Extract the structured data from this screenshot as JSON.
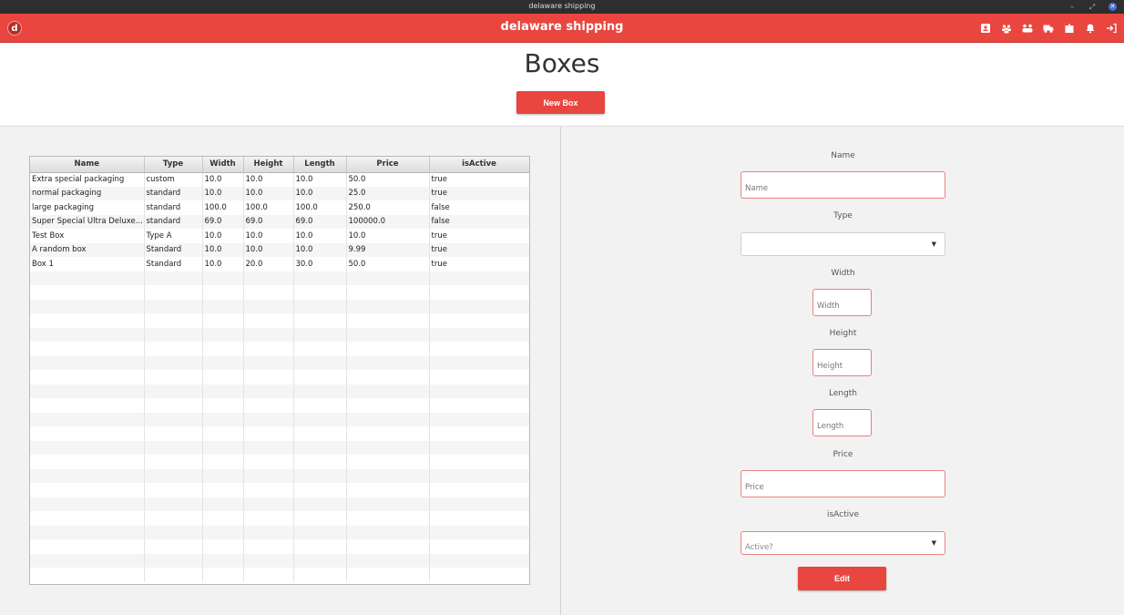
{
  "window": {
    "title": "delaware shipping"
  },
  "header": {
    "logo_letter": "d",
    "app_title": "delaware shipping"
  },
  "page": {
    "title": "Boxes",
    "new_box_label": "New Box"
  },
  "table": {
    "columns": [
      "Name",
      "Type",
      "Width",
      "Height",
      "Length",
      "Price",
      "isActive"
    ],
    "rows": [
      [
        "Extra special packaging",
        "custom",
        "10.0",
        "10.0",
        "10.0",
        "50.0",
        "true"
      ],
      [
        "normal packaging",
        "standard",
        "10.0",
        "10.0",
        "10.0",
        "25.0",
        "true"
      ],
      [
        "large packaging",
        "standard",
        "100.0",
        "100.0",
        "100.0",
        "250.0",
        "false"
      ],
      [
        "Super Special Ultra Deluxe...",
        "standard",
        "69.0",
        "69.0",
        "69.0",
        "100000.0",
        "false"
      ],
      [
        "Test Box",
        "Type A",
        "10.0",
        "10.0",
        "10.0",
        "10.0",
        "true"
      ],
      [
        "A random box",
        "Standard",
        "10.0",
        "10.0",
        "10.0",
        "9.99",
        "true"
      ],
      [
        "Box 1",
        "Standard",
        "10.0",
        "20.0",
        "30.0",
        "50.0",
        "true"
      ]
    ]
  },
  "form": {
    "name_label": "Name",
    "name_placeholder": "Name",
    "type_label": "Type",
    "type_value": "",
    "width_label": "Width",
    "width_placeholder": "Width",
    "height_label": "Height",
    "height_placeholder": "Height",
    "length_label": "Length",
    "length_placeholder": "Length",
    "price_label": "Price",
    "price_placeholder": "Price",
    "active_label": "isActive",
    "active_placeholder": "Active?",
    "edit_label": "Edit"
  },
  "icons": {
    "header": [
      "contacts-icon",
      "users-icon",
      "group-icon",
      "truck-icon",
      "box-icon",
      "bell-icon",
      "logout-icon"
    ]
  },
  "colors": {
    "accent": "#e8463f"
  }
}
